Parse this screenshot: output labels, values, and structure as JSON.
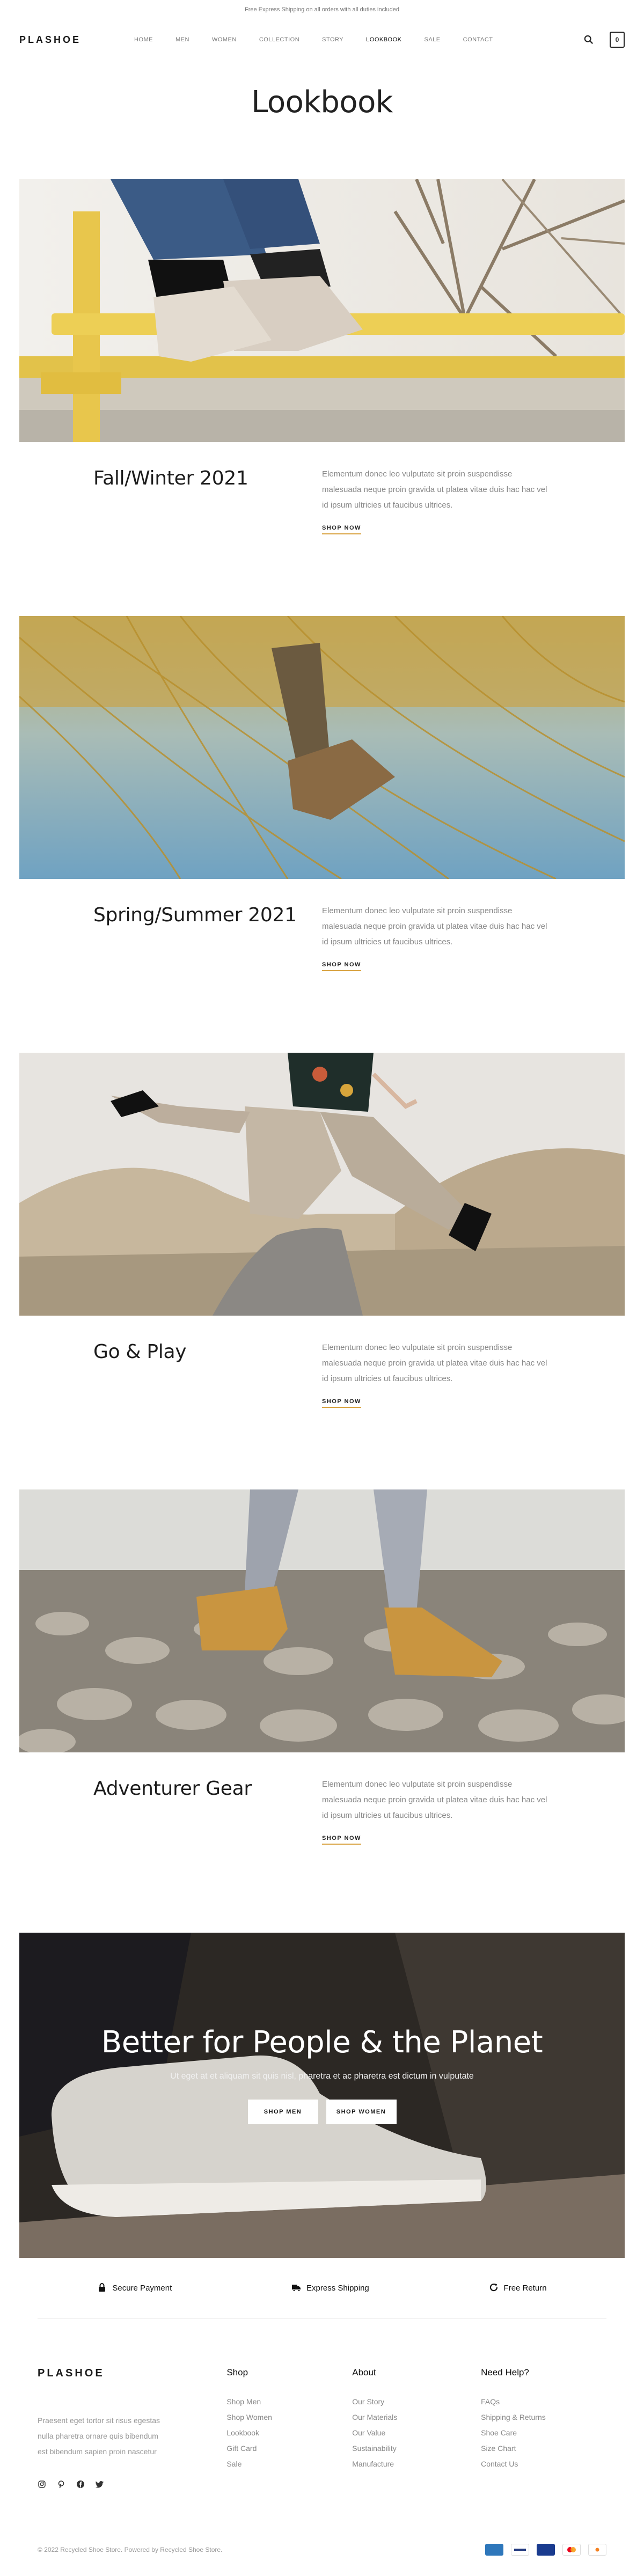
{
  "topbar": {
    "text": "Free Express Shipping on all orders with all duties included"
  },
  "header": {
    "logo": "PLASHOE",
    "nav": [
      "HOME",
      "MEN",
      "WOMEN",
      "COLLECTION",
      "STORY",
      "LOOKBOOK",
      "SALE",
      "CONTACT"
    ],
    "active_nav": "LOOKBOOK",
    "cart_count": "0",
    "icons": [
      "search-icon",
      "cart-icon"
    ]
  },
  "page": {
    "title": "Lookbook"
  },
  "looks": [
    {
      "title": "Fall/Winter 2021",
      "desc": "Elementum donec leo vulputate sit proin suspendisse malesuada neque proin gravida ut platea vitae duis hac hac vel id ipsum ultricies ut faucibus ultrices.",
      "link": "SHOP NOW"
    },
    {
      "title": "Spring/Summer 2021",
      "desc": "Elementum donec leo vulputate sit proin suspendisse malesuada neque proin gravida ut platea vitae duis hac hac vel id ipsum ultricies ut faucibus ultrices.",
      "link": "SHOP NOW"
    },
    {
      "title": "Go & Play",
      "desc": "Elementum donec leo vulputate sit proin suspendisse malesuada neque proin gravida ut platea vitae duis hac hac vel id ipsum ultricies ut faucibus ultrices.",
      "link": "SHOP NOW"
    },
    {
      "title": "Adventurer Gear",
      "desc": "Elementum donec leo vulputate sit proin suspendisse malesuada neque proin gravida ut platea vitae duis hac hac vel id ipsum ultricies ut faucibus ultrices.",
      "link": "SHOP NOW"
    }
  ],
  "hero": {
    "title": "Better for People & the Planet",
    "subtitle": "Ut eget at et aliquam sit quis nisl, pharetra et ac pharetra est dictum in vulputate",
    "btn_men": "SHOP MEN",
    "btn_women": "SHOP WOMEN"
  },
  "features": [
    {
      "icon": "lock-icon",
      "label": "Secure Payment"
    },
    {
      "icon": "truck-icon",
      "label": "Express Shipping"
    },
    {
      "icon": "refresh-icon",
      "label": "Free Return"
    }
  ],
  "footer": {
    "logo": "PLASHOE",
    "about": "Praesent eget tortor sit risus egestas nulla pharetra ornare quis bibendum est bibendum sapien proin nascetur",
    "socials": [
      "instagram-icon",
      "pinterest-icon",
      "facebook-icon",
      "twitter-icon"
    ],
    "columns": [
      {
        "title": "Shop",
        "links": [
          "Shop Men",
          "Shop Women",
          "Lookbook",
          "Gift Card",
          "Sale"
        ]
      },
      {
        "title": "About",
        "links": [
          "Our Story",
          "Our Materials",
          "Our Value",
          "Sustainability",
          "Manufacture"
        ]
      },
      {
        "title": "Need Help?",
        "links": [
          "FAQs",
          "Shipping & Returns",
          "Shoe Care",
          "Size Chart",
          "Contact Us"
        ]
      }
    ],
    "copyright": "© 2022 Recycled Shoe Store. Powered by Recycled Shoe Store.",
    "payments": [
      {
        "name": "amex-icon",
        "color": "#2e77bb"
      },
      {
        "name": "paypal-icon",
        "color": "#ffffff"
      },
      {
        "name": "visa-icon",
        "color": "#1a3b8f"
      },
      {
        "name": "mastercard-icon",
        "color": "#ffffff"
      },
      {
        "name": "discover-icon",
        "color": "#ffffff"
      }
    ]
  }
}
